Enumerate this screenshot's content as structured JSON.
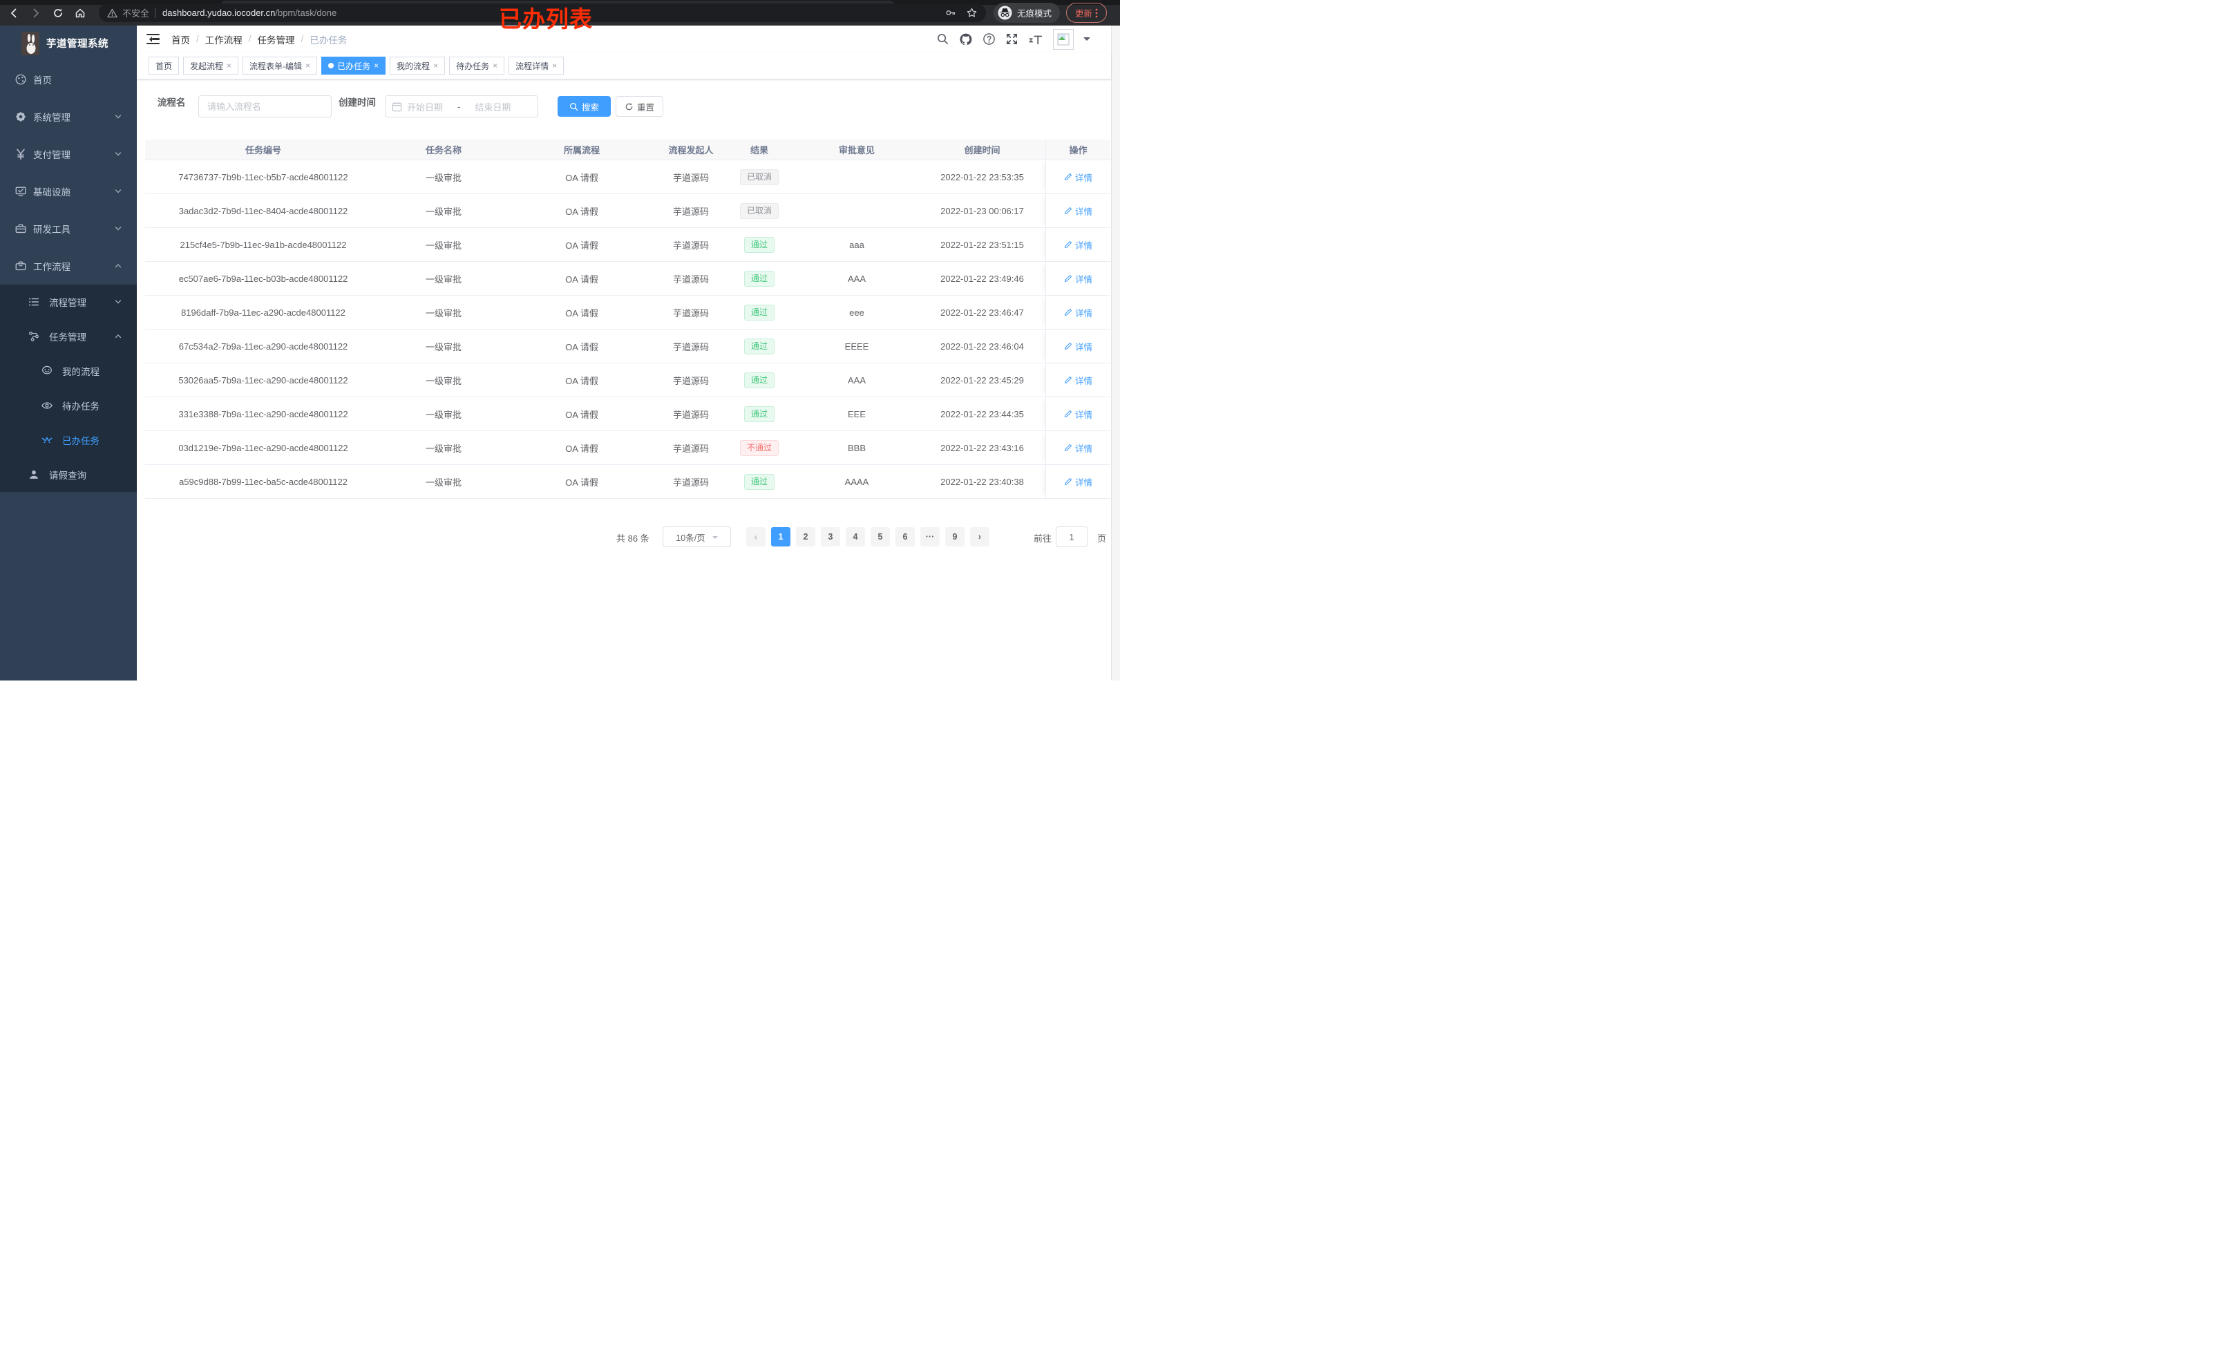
{
  "browser": {
    "security_label": "不安全",
    "url_host": "dashboard.yudao.iocoder.cn",
    "url_path": "/bpm/task/done",
    "incognito_label": "无痕模式",
    "update_label": "更新",
    "annotation": "已办列表"
  },
  "sidebar": {
    "app_title": "芋道管理系统",
    "home": "首页",
    "system": "系统管理",
    "pay": "支付管理",
    "infra": "基础设施",
    "dev": "研发工具",
    "workflow": "工作流程",
    "process_mgmt": "流程管理",
    "task_mgmt": "任务管理",
    "my_process": "我的流程",
    "todo": "待办任务",
    "done": "已办任务",
    "leave_query": "请假查询"
  },
  "breadcrumb": {
    "items": [
      "首页",
      "工作流程",
      "任务管理",
      "已办任务"
    ]
  },
  "tabs": {
    "items": [
      {
        "label": "首页"
      },
      {
        "label": "发起流程"
      },
      {
        "label": "流程表单-编辑"
      },
      {
        "label": "已办任务"
      },
      {
        "label": "我的流程"
      },
      {
        "label": "待办任务"
      },
      {
        "label": "流程详情"
      }
    ]
  },
  "filters": {
    "name_label": "流程名",
    "name_placeholder": "请输入流程名",
    "date_label": "创建时间",
    "date_start_placeholder": "开始日期",
    "date_end_placeholder": "结束日期",
    "search_label": "搜索",
    "reset_label": "重置"
  },
  "table": {
    "columns": [
      "任务编号",
      "任务名称",
      "所属流程",
      "流程发起人",
      "结果",
      "审批意见",
      "创建时间",
      "操作"
    ],
    "action_label": "详情",
    "rows": [
      {
        "id": "74736737-7b9b-11ec-b5b7-acde48001122",
        "name": "一级审批",
        "process": "OA 请假",
        "initiator": "芋道源码",
        "result": "已取消",
        "result_type": "info",
        "comment": "",
        "created": "2022-01-22 23:53:35"
      },
      {
        "id": "3adac3d2-7b9d-11ec-8404-acde48001122",
        "name": "一级审批",
        "process": "OA 请假",
        "initiator": "芋道源码",
        "result": "已取消",
        "result_type": "info",
        "comment": "",
        "created": "2022-01-23 00:06:17"
      },
      {
        "id": "215cf4e5-7b9b-11ec-9a1b-acde48001122",
        "name": "一级审批",
        "process": "OA 请假",
        "initiator": "芋道源码",
        "result": "通过",
        "result_type": "success",
        "comment": "aaa",
        "created": "2022-01-22 23:51:15"
      },
      {
        "id": "ec507ae6-7b9a-11ec-b03b-acde48001122",
        "name": "一级审批",
        "process": "OA 请假",
        "initiator": "芋道源码",
        "result": "通过",
        "result_type": "success",
        "comment": "AAA",
        "created": "2022-01-22 23:49:46"
      },
      {
        "id": "8196daff-7b9a-11ec-a290-acde48001122",
        "name": "一级审批",
        "process": "OA 请假",
        "initiator": "芋道源码",
        "result": "通过",
        "result_type": "success",
        "comment": "eee",
        "created": "2022-01-22 23:46:47"
      },
      {
        "id": "67c534a2-7b9a-11ec-a290-acde48001122",
        "name": "一级审批",
        "process": "OA 请假",
        "initiator": "芋道源码",
        "result": "通过",
        "result_type": "success",
        "comment": "EEEE",
        "created": "2022-01-22 23:46:04"
      },
      {
        "id": "53026aa5-7b9a-11ec-a290-acde48001122",
        "name": "一级审批",
        "process": "OA 请假",
        "initiator": "芋道源码",
        "result": "通过",
        "result_type": "success",
        "comment": "AAA",
        "created": "2022-01-22 23:45:29"
      },
      {
        "id": "331e3388-7b9a-11ec-a290-acde48001122",
        "name": "一级审批",
        "process": "OA 请假",
        "initiator": "芋道源码",
        "result": "通过",
        "result_type": "success",
        "comment": "EEE",
        "created": "2022-01-22 23:44:35"
      },
      {
        "id": "03d1219e-7b9a-11ec-a290-acde48001122",
        "name": "一级审批",
        "process": "OA 请假",
        "initiator": "芋道源码",
        "result": "不通过",
        "result_type": "danger",
        "comment": "BBB",
        "created": "2022-01-22 23:43:16"
      },
      {
        "id": "a59c9d88-7b99-11ec-ba5c-acde48001122",
        "name": "一级审批",
        "process": "OA 请假",
        "initiator": "芋道源码",
        "result": "通过",
        "result_type": "success",
        "comment": "AAAA",
        "created": "2022-01-22 23:40:38"
      }
    ]
  },
  "pagination": {
    "total_label": "共 86 条",
    "page_size": "10条/页",
    "pages": [
      "1",
      "2",
      "3",
      "4",
      "5",
      "6",
      "···",
      "9"
    ],
    "goto_label": "前往",
    "goto_value": "1",
    "goto_unit": "页"
  },
  "ui": {
    "close": "×",
    "prev": "‹",
    "next": "›",
    "date_sep": "-",
    "breadcrumb_sep": "/"
  },
  "colors": {
    "accent": "#409eff",
    "success": "#3fc77a",
    "danger": "#f56c6c",
    "info": "#909399",
    "sidebar": "#304156",
    "sidebar_submenu": "#1f2d3d",
    "annotation": "#ff2d05"
  }
}
